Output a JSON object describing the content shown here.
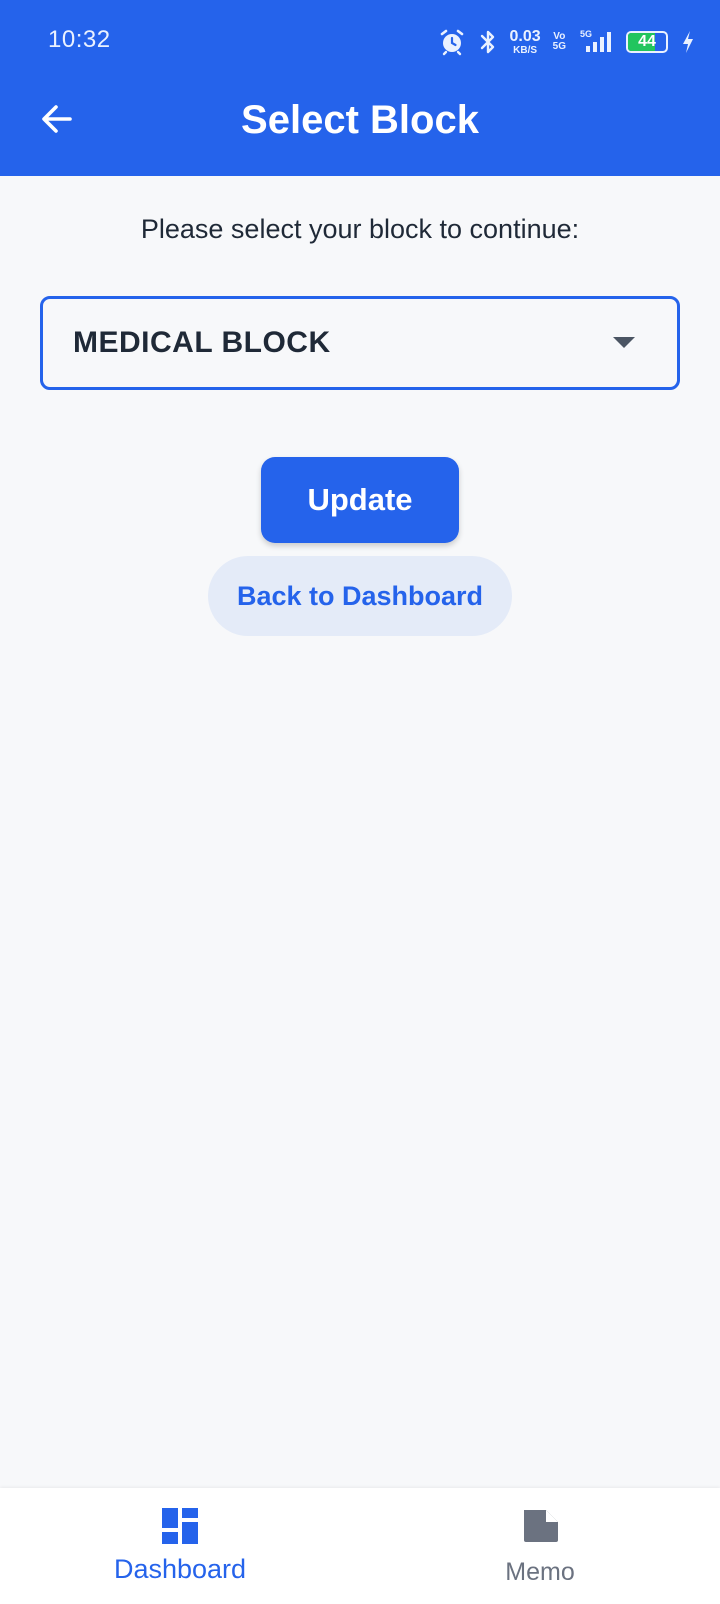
{
  "status_bar": {
    "time": "10:32",
    "net_speed_value": "0.03",
    "net_speed_unit": "KB/S",
    "volte_top": "Vo",
    "volte_bottom": "5G",
    "signal_label": "5G",
    "battery_level": "44",
    "icons": [
      "alarm-icon",
      "bluetooth-icon",
      "signal-icon",
      "battery-icon",
      "charging-icon"
    ]
  },
  "header": {
    "title": "Select Block",
    "back_icon": "arrow-left-icon"
  },
  "main": {
    "instruction": "Please select your block to continue:",
    "block_select": {
      "selected_value": "MEDICAL BLOCK",
      "caret_icon": "caret-down-icon"
    },
    "update_label": "Update",
    "back_label": "Back to Dashboard"
  },
  "bottom_nav": {
    "items": [
      {
        "label": "Dashboard",
        "icon": "dashboard-icon",
        "active": true
      },
      {
        "label": "Memo",
        "icon": "memo-icon",
        "active": false
      }
    ]
  },
  "colors": {
    "primary": "#2563EB",
    "background": "#F7F8FA",
    "secondary_button_bg": "#E4EBF8",
    "text_dark": "#1F2937",
    "inactive_nav": "#6B7280",
    "battery_green": "#22C55E"
  }
}
